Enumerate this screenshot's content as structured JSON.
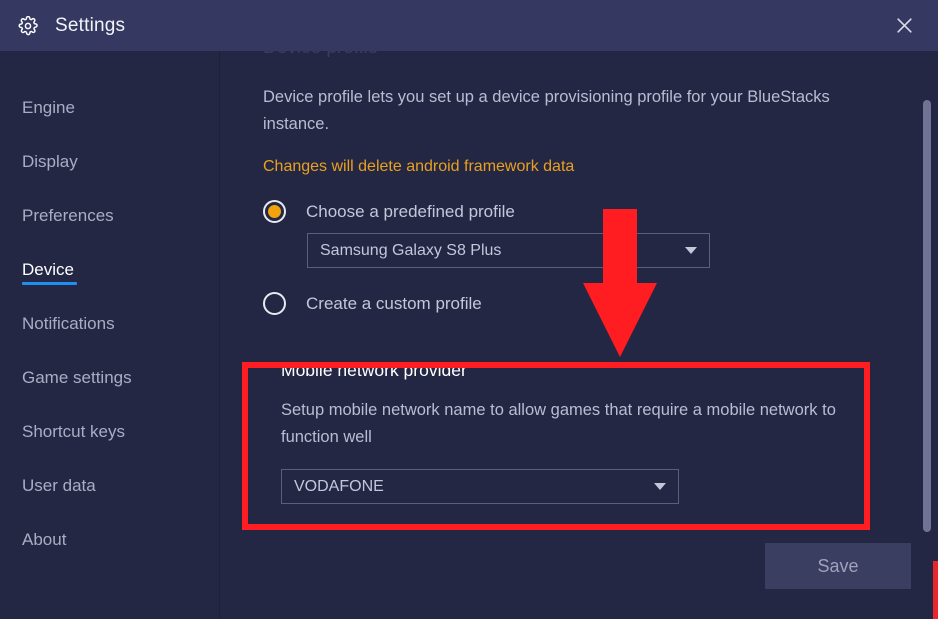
{
  "window": {
    "title": "Settings",
    "gear_icon": "gear-icon",
    "close_icon": "close-icon"
  },
  "sidebar": {
    "items": [
      {
        "label": "Engine",
        "active": false
      },
      {
        "label": "Display",
        "active": false
      },
      {
        "label": "Preferences",
        "active": false
      },
      {
        "label": "Device",
        "active": true
      },
      {
        "label": "Notifications",
        "active": false
      },
      {
        "label": "Game settings",
        "active": false
      },
      {
        "label": "Shortcut keys",
        "active": false
      },
      {
        "label": "User data",
        "active": false
      },
      {
        "label": "About",
        "active": false
      }
    ]
  },
  "main": {
    "device_profile": {
      "heading": "Device profile",
      "description": "Device profile lets you set up a device provisioning profile for your BlueStacks instance.",
      "warning": "Changes will delete android framework data",
      "option_predefined_label": "Choose a predefined profile",
      "option_custom_label": "Create a custom profile",
      "predefined_selected": true,
      "custom_selected": false,
      "profile_select_value": "Samsung Galaxy S8 Plus"
    },
    "mobile_network": {
      "heading": "Mobile network provider",
      "description": "Setup mobile network name to allow games that require a mobile network to function well",
      "provider_select_value": "VODAFONE"
    },
    "save_label": "Save"
  },
  "colors": {
    "titlebar_bg": "#353860",
    "window_bg": "#242744",
    "accent_blue": "#1f8ff0",
    "warning_orange": "#e8a020",
    "radio_orange": "#f2a20c",
    "annotation_red": "#ff1d21",
    "scrollbar_thumb": "#6f7492"
  }
}
